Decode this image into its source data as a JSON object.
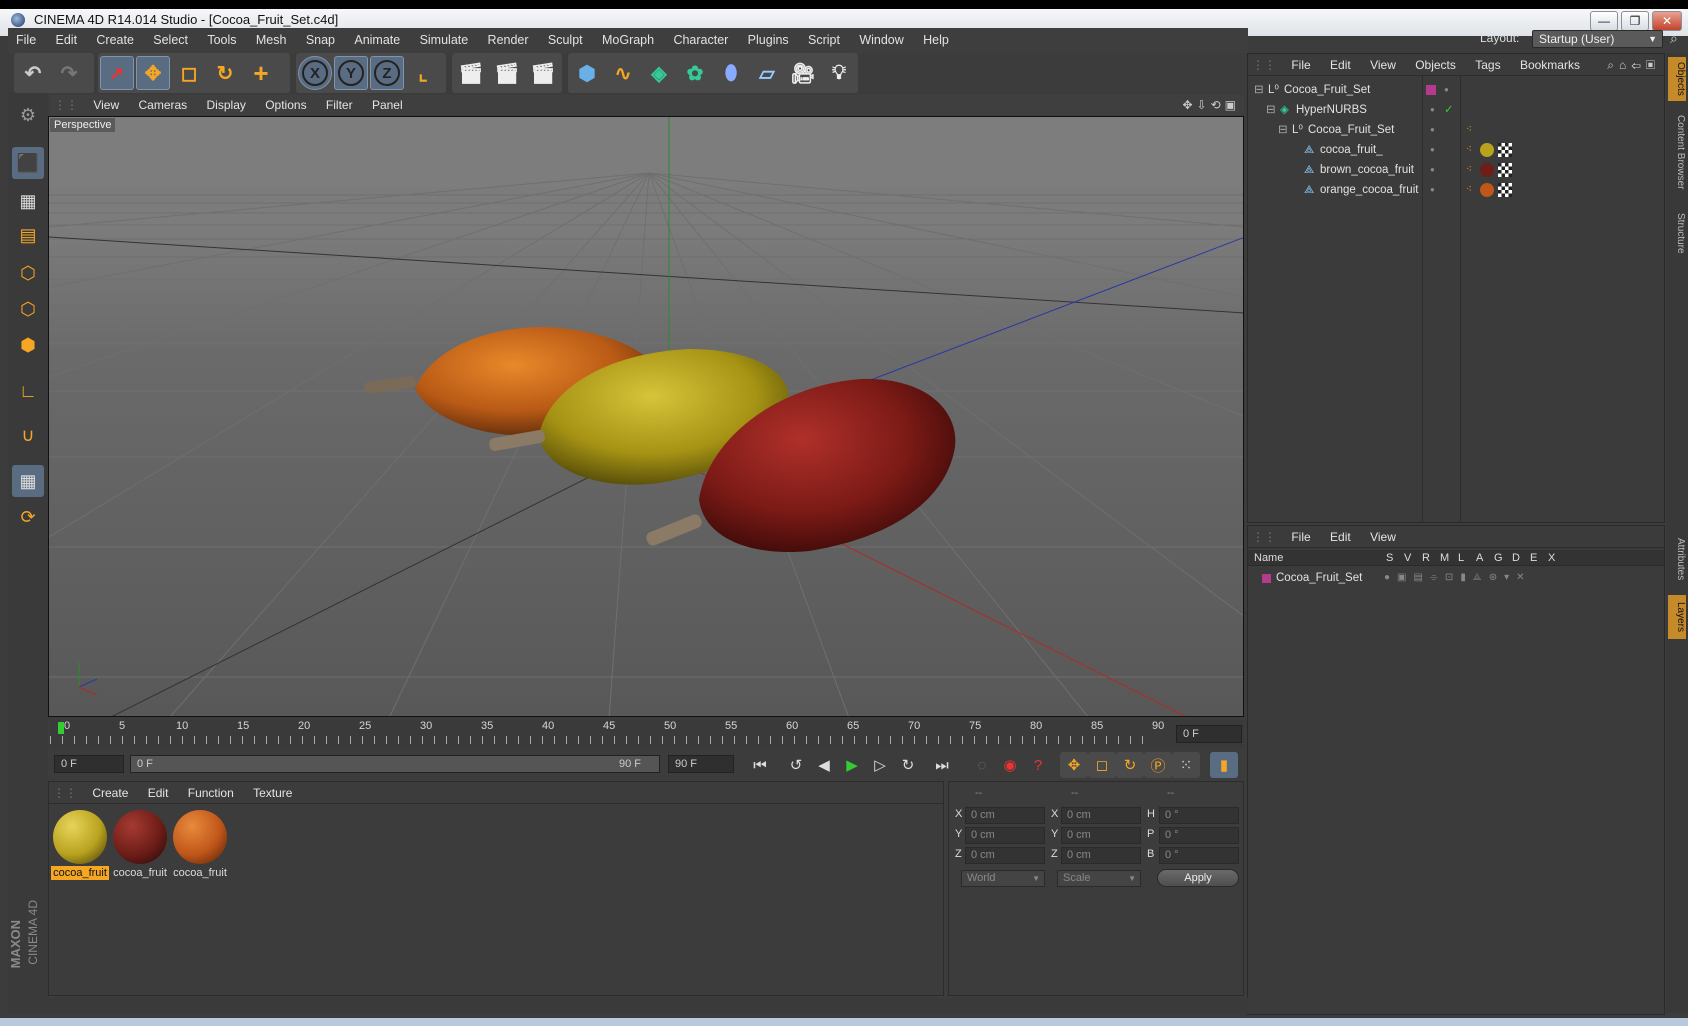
{
  "window": {
    "title": "CINEMA 4D R14.014 Studio - [Cocoa_Fruit_Set.c4d]",
    "minimize": "—",
    "restore": "❐",
    "close": "✕"
  },
  "menu": [
    "File",
    "Edit",
    "Create",
    "Select",
    "Tools",
    "Mesh",
    "Snap",
    "Animate",
    "Simulate",
    "Render",
    "Sculpt",
    "MoGraph",
    "Character",
    "Plugins",
    "Script",
    "Window",
    "Help"
  ],
  "layout": {
    "label": "Layout:",
    "value": "Startup (User)"
  },
  "toolbar": {
    "undo": "↶",
    "redo": "↷",
    "move": "✥",
    "scale": "◻",
    "rotate": "↻",
    "add": "+",
    "x": "X",
    "y": "Y",
    "z": "Z"
  },
  "viewport": {
    "menu": [
      "View",
      "Cameras",
      "Display",
      "Options",
      "Filter",
      "Panel"
    ],
    "label": "Perspective"
  },
  "timeline": {
    "ticks": [
      "0",
      "5",
      "10",
      "15",
      "20",
      "25",
      "30",
      "35",
      "40",
      "45",
      "50",
      "55",
      "60",
      "65",
      "70",
      "75",
      "80",
      "85",
      "90"
    ],
    "current": "0 F",
    "start": "0 F",
    "range_start": "0 F",
    "range_end": "90 F",
    "end": "90 F"
  },
  "material_manager": {
    "menu": [
      "Create",
      "Edit",
      "Function",
      "Texture"
    ],
    "materials": [
      {
        "label": "cocoa_fruit",
        "color": "#b9a21e",
        "selected": true
      },
      {
        "label": "cocoa_fruit",
        "color": "#6e1d18",
        "selected": false
      },
      {
        "label": "cocoa_fruit",
        "color": "#c0561a",
        "selected": false
      }
    ]
  },
  "coordinates": {
    "headers": [
      "--",
      "--",
      "--"
    ],
    "rows": [
      {
        "a": "X",
        "av": "0 cm",
        "b": "X",
        "bv": "0 cm",
        "c": "H",
        "cv": "0 °"
      },
      {
        "a": "Y",
        "av": "0 cm",
        "b": "Y",
        "bv": "0 cm",
        "c": "P",
        "cv": "0 °"
      },
      {
        "a": "Z",
        "av": "0 cm",
        "b": "Z",
        "bv": "0 cm",
        "c": "B",
        "cv": "0 °"
      }
    ],
    "mode1": "World",
    "mode2": "Scale",
    "apply": "Apply"
  },
  "object_manager": {
    "menu": [
      "File",
      "Edit",
      "View",
      "Objects",
      "Tags",
      "Bookmarks"
    ],
    "objects": [
      {
        "name": "Cocoa_Fruit_Set",
        "indent": 0,
        "icon": "null-icon"
      },
      {
        "name": "HyperNURBS",
        "indent": 1,
        "icon": "hypernurbs-icon"
      },
      {
        "name": "Cocoa_Fruit_Set",
        "indent": 2,
        "icon": "null-icon"
      },
      {
        "name": "cocoa_fruit_",
        "indent": 3,
        "icon": "polygon-icon"
      },
      {
        "name": "brown_cocoa_fruit",
        "indent": 3,
        "icon": "polygon-icon"
      },
      {
        "name": "orange_cocoa_fruit",
        "indent": 3,
        "icon": "polygon-icon"
      }
    ]
  },
  "layer_manager": {
    "menu": [
      "File",
      "Edit",
      "View"
    ],
    "columns": [
      "Name",
      "S",
      "V",
      "R",
      "M",
      "L",
      "A",
      "G",
      "D",
      "E",
      "X"
    ],
    "layers": [
      {
        "name": "Cocoa_Fruit_Set"
      }
    ]
  },
  "right_tabs": [
    "Objects",
    "Content Browser",
    "Structure",
    "Attributes",
    "Layers"
  ],
  "brand": {
    "maxon": "MAXON",
    "product": "CINEMA 4D"
  },
  "colors": {
    "accent": "#f5a623",
    "selection": "#5a6c82",
    "bg": "#3c3c3c"
  }
}
